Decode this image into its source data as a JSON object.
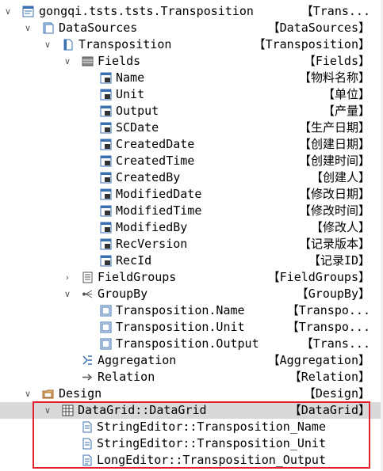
{
  "tree": {
    "root": {
      "name": "gongqi.tsts.tsts.Transposition",
      "tag": "【Trans..."
    },
    "datasources": {
      "name": "DataSources",
      "tag": "【DataSources】"
    },
    "transposition": {
      "name": "Transposition",
      "tag": "【Transposition】"
    },
    "fields": {
      "name": "Fields",
      "tag": "【Fields】",
      "items": [
        {
          "name": "Name",
          "tag": "【物料名称】"
        },
        {
          "name": "Unit",
          "tag": "【单位】"
        },
        {
          "name": "Output",
          "tag": "【产量】"
        },
        {
          "name": "SCDate",
          "tag": "【生产日期】"
        },
        {
          "name": "CreatedDate",
          "tag": "【创建日期】"
        },
        {
          "name": "CreatedTime",
          "tag": "【创建时间】"
        },
        {
          "name": "CreatedBy",
          "tag": "【创建人】"
        },
        {
          "name": "ModifiedDate",
          "tag": "【修改日期】"
        },
        {
          "name": "ModifiedTime",
          "tag": "【修改时间】"
        },
        {
          "name": "ModifiedBy",
          "tag": "【修改人】"
        },
        {
          "name": "RecVersion",
          "tag": "【记录版本】"
        },
        {
          "name": "RecId",
          "tag": "【记录ID】"
        }
      ]
    },
    "fieldgroups": {
      "name": "FieldGroups",
      "tag": "【FieldGroups】"
    },
    "groupby": {
      "name": "GroupBy",
      "tag": "【GroupBy】",
      "items": [
        {
          "name": "Transposition.Name",
          "tag": "【Transpo..."
        },
        {
          "name": "Transposition.Unit",
          "tag": "【Transpo..."
        },
        {
          "name": "Transposition.Output",
          "tag": "【Trans..."
        }
      ]
    },
    "aggregation": {
      "name": "Aggregation",
      "tag": "【Aggregation】"
    },
    "relation": {
      "name": "Relation",
      "tag": "【Relation】"
    },
    "design": {
      "name": "Design",
      "tag": "【Design】"
    },
    "datagrid": {
      "name": "DataGrid::DataGrid",
      "tag": "【DataGrid】"
    },
    "editors": [
      {
        "name": "StringEditor::Transposition_Name"
      },
      {
        "name": "StringEditor::Transposition_Unit"
      },
      {
        "name": "LongEditor::Transposition_Output"
      }
    ]
  },
  "colors": {
    "highlight_border": "#e0202a",
    "selected_row": "#d9d9d9"
  }
}
